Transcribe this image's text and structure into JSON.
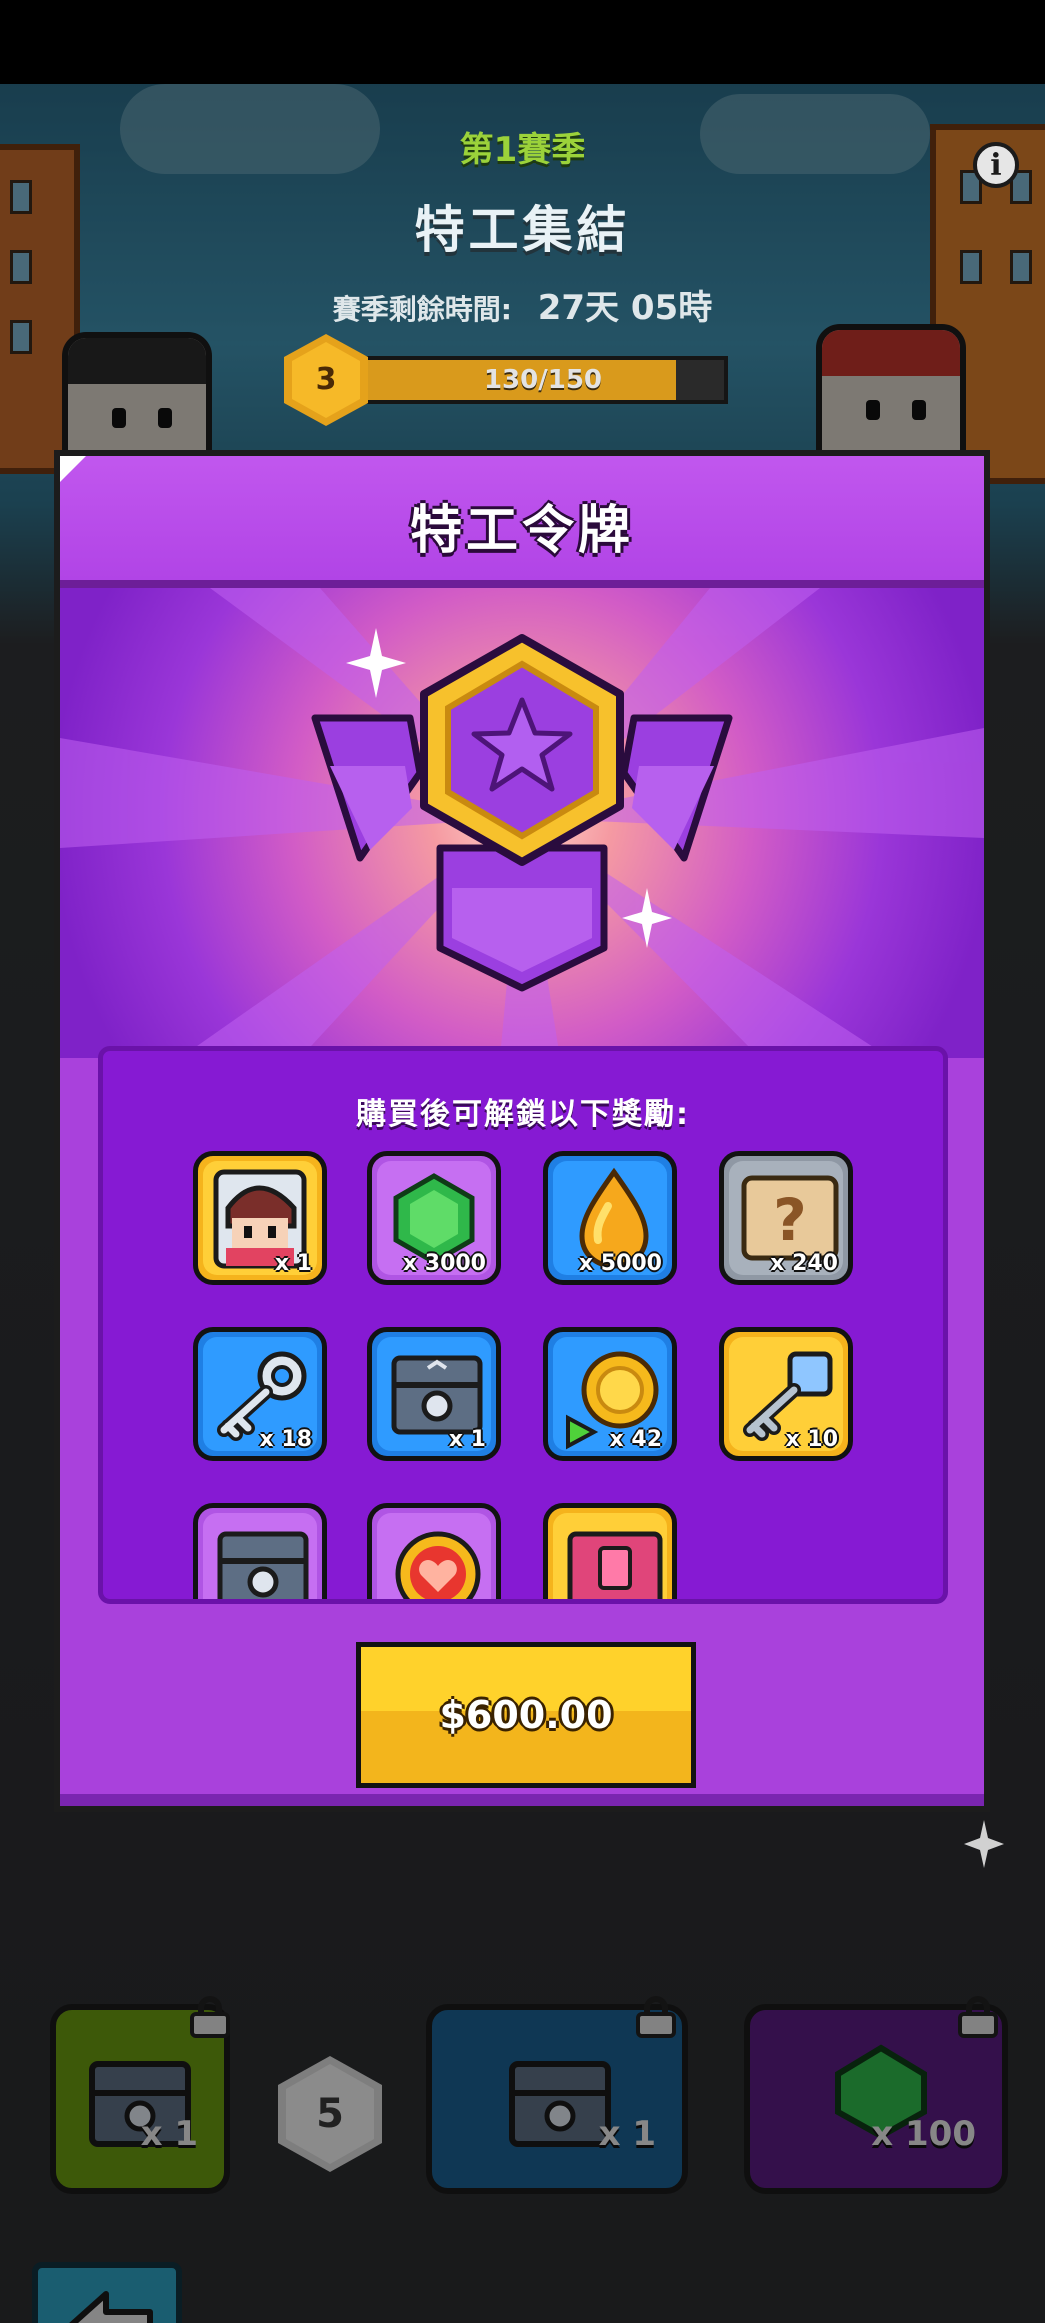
{
  "season": {
    "label": "第1賽季",
    "event_name": "特工集結",
    "remaining_label": "賽季剩餘時間:",
    "remaining_value": "27天 05時",
    "level": "3",
    "xp_text": "130/150",
    "xp_progress": 0.8667
  },
  "modal": {
    "title": "特工令牌",
    "rewards_caption": "購買後可解鎖以下獎勵:",
    "price_label": "$600.00",
    "rewards": [
      {
        "icon": "agent-character-icon",
        "qty": "x 1",
        "frame": "gold"
      },
      {
        "icon": "green-gem-icon",
        "qty": "x 3000",
        "frame": "purple"
      },
      {
        "icon": "golden-drop-icon",
        "qty": "x 5000",
        "frame": "blue"
      },
      {
        "icon": "mystery-map-icon",
        "qty": "x 240",
        "frame": "gray"
      },
      {
        "icon": "silver-key-icon",
        "qty": "x 18",
        "frame": "blue"
      },
      {
        "icon": "blue-chest-icon",
        "qty": "x 1",
        "frame": "blue"
      },
      {
        "icon": "gold-coin-icon",
        "qty": "x 42",
        "frame": "blue"
      },
      {
        "icon": "gold-key-icon",
        "qty": "x 10",
        "frame": "gold"
      },
      {
        "icon": "purple-chest-icon",
        "qty": "",
        "frame": "purple"
      },
      {
        "icon": "heart-token-icon",
        "qty": "",
        "frame": "purple"
      },
      {
        "icon": "pink-chest-icon",
        "qty": "",
        "frame": "gold"
      }
    ]
  },
  "background_rewards": [
    {
      "icon": "chest-icon",
      "qty": "x 1",
      "color": "#6a9a10"
    },
    {
      "icon": "chest-icon",
      "qty": "x 1",
      "color": "#1a5f91"
    },
    {
      "icon": "green-gem-icon",
      "qty": "x 100",
      "color": "#5b1d82"
    }
  ],
  "background_level_marker": "5",
  "colors": {
    "modal_bg": "#a941dc",
    "panel_bg": "#861ad3",
    "buy_button": "#ffd22b"
  }
}
